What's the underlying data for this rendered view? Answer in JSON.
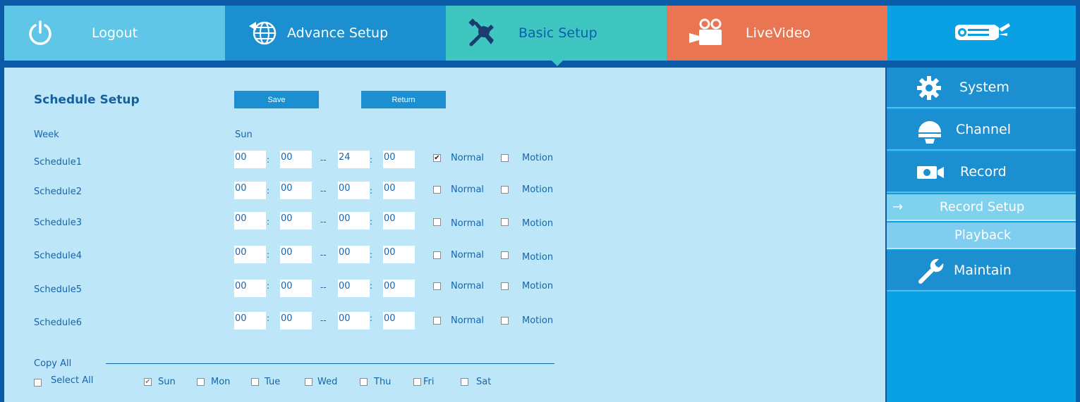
{
  "nav": {
    "logout": "Logout",
    "advance": "Advance Setup",
    "basic": "Basic Setup",
    "live": "LiveVideo"
  },
  "page": {
    "title": "Schedule Setup",
    "save": "Save",
    "return": "Return",
    "week_label": "Week",
    "week_value": "Sun",
    "copy_all": "Copy All",
    "select_all": "Select All"
  },
  "schedules": [
    {
      "label": "Schedule1",
      "sh": "00",
      "sm": "00",
      "eh": "24",
      "em": "00",
      "normal": true,
      "motion": false
    },
    {
      "label": "Schedule2",
      "sh": "00",
      "sm": "00",
      "eh": "00",
      "em": "00",
      "normal": false,
      "motion": false
    },
    {
      "label": "Schedule3",
      "sh": "00",
      "sm": "00",
      "eh": "00",
      "em": "00",
      "normal": false,
      "motion": false
    },
    {
      "label": "Schedule4",
      "sh": "00",
      "sm": "00",
      "eh": "00",
      "em": "00",
      "normal": false,
      "motion": false
    },
    {
      "label": "Schedule5",
      "sh": "00",
      "sm": "00",
      "eh": "00",
      "em": "00",
      "normal": false,
      "motion": false
    },
    {
      "label": "Schedule6",
      "sh": "00",
      "sm": "00",
      "eh": "00",
      "em": "00",
      "normal": false,
      "motion": false
    }
  ],
  "mode_labels": {
    "normal": "Normal",
    "motion": "Motion"
  },
  "time_sep": ":",
  "range_sep": "--",
  "days": [
    {
      "label": "Sun",
      "checked": true
    },
    {
      "label": "Mon",
      "checked": false
    },
    {
      "label": "Tue",
      "checked": false
    },
    {
      "label": "Wed",
      "checked": false
    },
    {
      "label": "Thu",
      "checked": false
    },
    {
      "label": "Fri",
      "checked": false
    },
    {
      "label": "Sat",
      "checked": false
    }
  ],
  "sidebar": {
    "system": "System",
    "channel": "Channel",
    "record": "Record",
    "record_setup": "Record Setup",
    "playback": "Playback",
    "maintain": "Maintain",
    "arrow": "→"
  },
  "icons": [
    "power-icon",
    "globe-icon",
    "tools-icon",
    "video-camera-icon",
    "bullet-camera-logo-icon",
    "gear-icon",
    "dome-camera-icon",
    "record-camera-icon",
    "arrow-right-icon",
    "wrench-icon"
  ]
}
